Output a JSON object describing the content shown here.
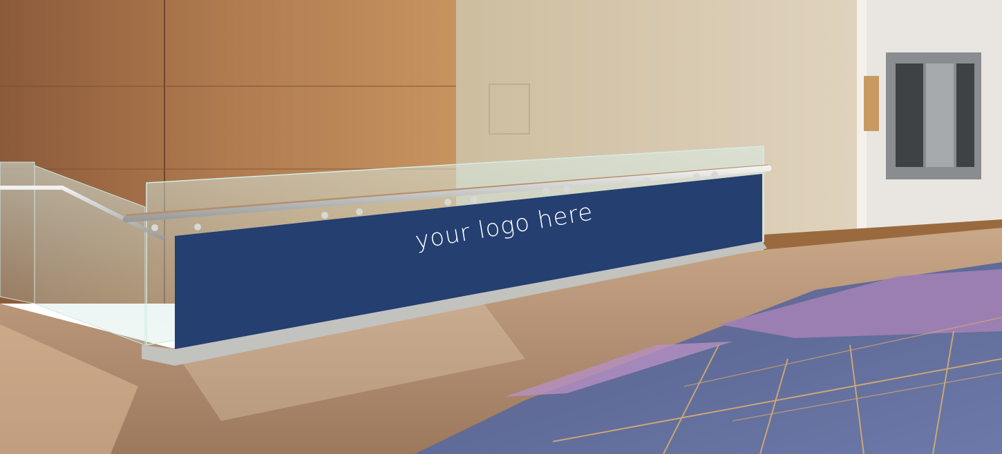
{
  "banner": {
    "text": "your logo here",
    "color": "#243f70",
    "text_color": "#ffffff"
  },
  "colors": {
    "wood": "#a36f46",
    "wall": "#d6c7ae",
    "floor": "#b18a6a",
    "carpet_blue": "#6f7ba6",
    "carpet_purple": "#a683b6"
  }
}
